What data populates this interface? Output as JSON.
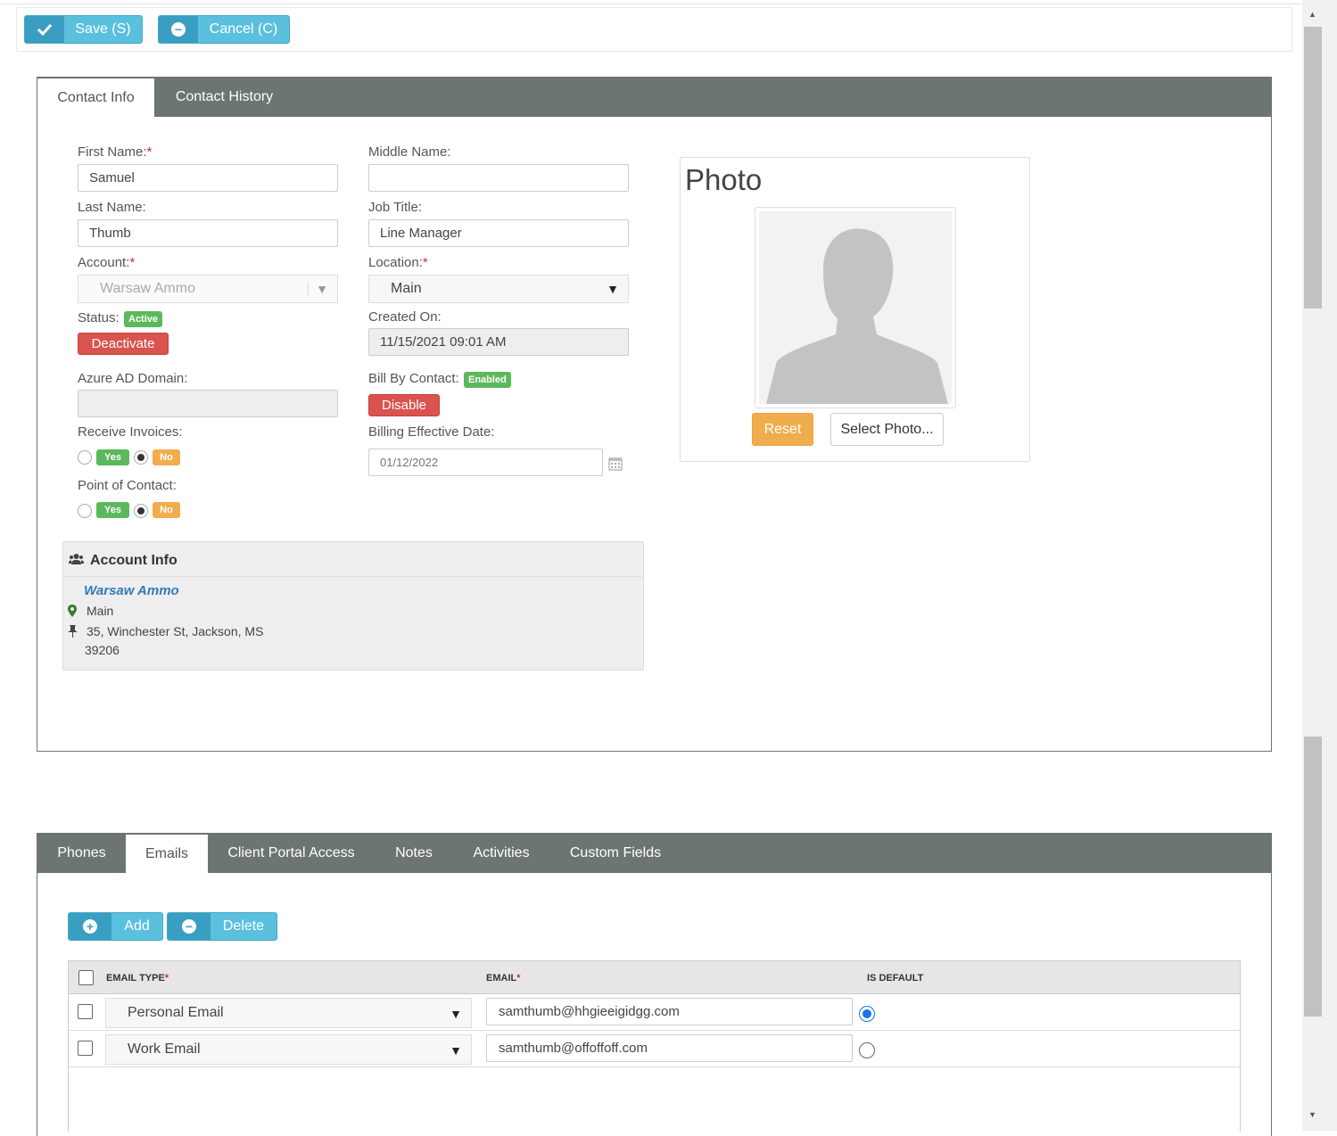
{
  "toolbar": {
    "save_label": "Save (S)",
    "cancel_label": "Cancel (C)"
  },
  "contact_tabs": {
    "tab1": "Contact Info",
    "tab2": "Contact History"
  },
  "form": {
    "first_name_label": "First Name:",
    "first_name": "Samuel",
    "middle_name_label": "Middle Name:",
    "middle_name": "",
    "last_name_label": "Last Name:",
    "last_name": "Thumb",
    "job_title_label": "Job Title:",
    "job_title": "Line Manager",
    "account_label": "Account:",
    "account": "Warsaw Ammo",
    "location_label": "Location:",
    "location": "Main",
    "status_label": "Status:",
    "status_badge": "Active",
    "deactivate_label": "Deactivate",
    "created_on_label": "Created On:",
    "created_on": "11/15/2021 09:01 AM",
    "azure_label": "Azure AD Domain:",
    "azure_value": "",
    "bill_by_contact_label": "Bill By Contact:",
    "bill_badge": "Enabled",
    "disable_label": "Disable",
    "receive_invoices_label": "Receive Invoices:",
    "billing_date_label": "Billing Effective Date:",
    "billing_date_placeholder": "01/12/2022",
    "point_of_contact_label": "Point of Contact:",
    "yes": "Yes",
    "no": "No",
    "req_mark": "*"
  },
  "photo": {
    "title": "Photo",
    "reset_label": "Reset",
    "select_label": "Select Photo..."
  },
  "account_info": {
    "title": "Account Info",
    "name": "Warsaw Ammo",
    "location": "Main",
    "address_line1": "35, Winchester St, Jackson, MS",
    "address_line2": "39206"
  },
  "detail_tabs": [
    "Phones",
    "Emails",
    "Client Portal Access",
    "Notes",
    "Activities",
    "Custom Fields"
  ],
  "emails": {
    "add_label": "Add",
    "delete_label": "Delete",
    "col_type": "EMAIL TYPE",
    "col_email": "EMAIL",
    "col_default": "IS DEFAULT",
    "rows": [
      {
        "type": "Personal Email",
        "email": "samthumb@hhgieeigidgg.com",
        "is_default": true
      },
      {
        "type": "Work Email",
        "email": "samthumb@offoffoff.com",
        "is_default": false
      }
    ]
  }
}
